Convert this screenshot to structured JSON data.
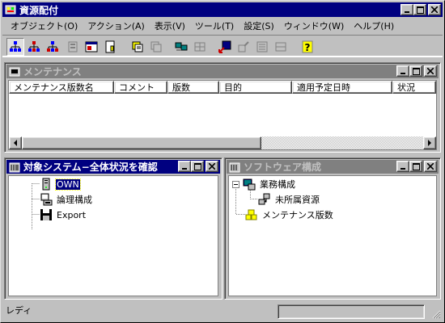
{
  "window": {
    "title": "資源配付"
  },
  "menu": [
    "オブジェクト(O)",
    "アクション(A)",
    "表示(V)",
    "ツール(T)",
    "設定(S)",
    "ウィンドウ(W)",
    "ヘルプ(H)"
  ],
  "toolbar": {
    "buttons": [
      "tree-view-icon",
      "tree-red-icon",
      "tree-blue-icon",
      "properties-icon",
      "window-icon",
      "document-icon",
      "copy-icon",
      "copy-disabled-icon",
      "computers-icon",
      "network-disabled-icon",
      "export-icon",
      "import-disabled-icon",
      "list-disabled-icon",
      "grid-disabled-icon",
      "help-icon"
    ]
  },
  "maintenance": {
    "title": "メンテナンス",
    "columns": [
      "メンテナンス版数名",
      "コメント",
      "版数",
      "目的",
      "適用予定日時",
      "状況"
    ]
  },
  "target": {
    "title": "対象システム−全体状況を確認",
    "items": [
      {
        "label": "OWN",
        "selected": true
      },
      {
        "label": "論理構成",
        "selected": false
      },
      {
        "label": "Export",
        "selected": false
      }
    ]
  },
  "software": {
    "title": "ソフトウェア構成",
    "root": "業務構成",
    "child": "未所属資源",
    "sibling": "メンテナンス版数"
  },
  "status": {
    "text": "レディ"
  },
  "colors": {
    "title_active": "#000080",
    "title_inactive": "#808080",
    "face": "#c0c0c0"
  }
}
